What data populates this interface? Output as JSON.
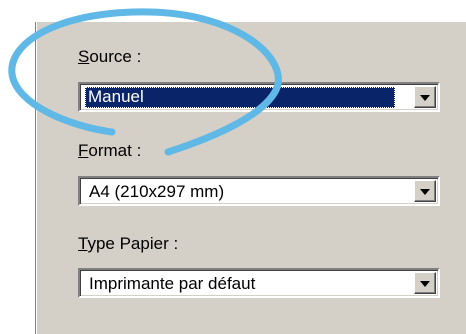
{
  "fields": [
    {
      "label_prefix": "",
      "label_accel": "S",
      "label_rest": "ource :",
      "value": "Manuel",
      "selected": true
    },
    {
      "label_prefix": "",
      "label_accel": "F",
      "label_rest": "ormat :",
      "value": "A4 (210x297 mm)",
      "selected": false
    },
    {
      "label_prefix": "",
      "label_accel": "T",
      "label_rest": "ype Papier :",
      "value": "Imprimante par défaut",
      "selected": false
    }
  ],
  "annotation": {
    "color": "#5fb8e6",
    "shape": "ellipse-highlight"
  },
  "icons": {
    "dropdown": "chevron-down-icon"
  },
  "colors": {
    "panel": "#d4d0c8",
    "selection": "#0a246a"
  }
}
